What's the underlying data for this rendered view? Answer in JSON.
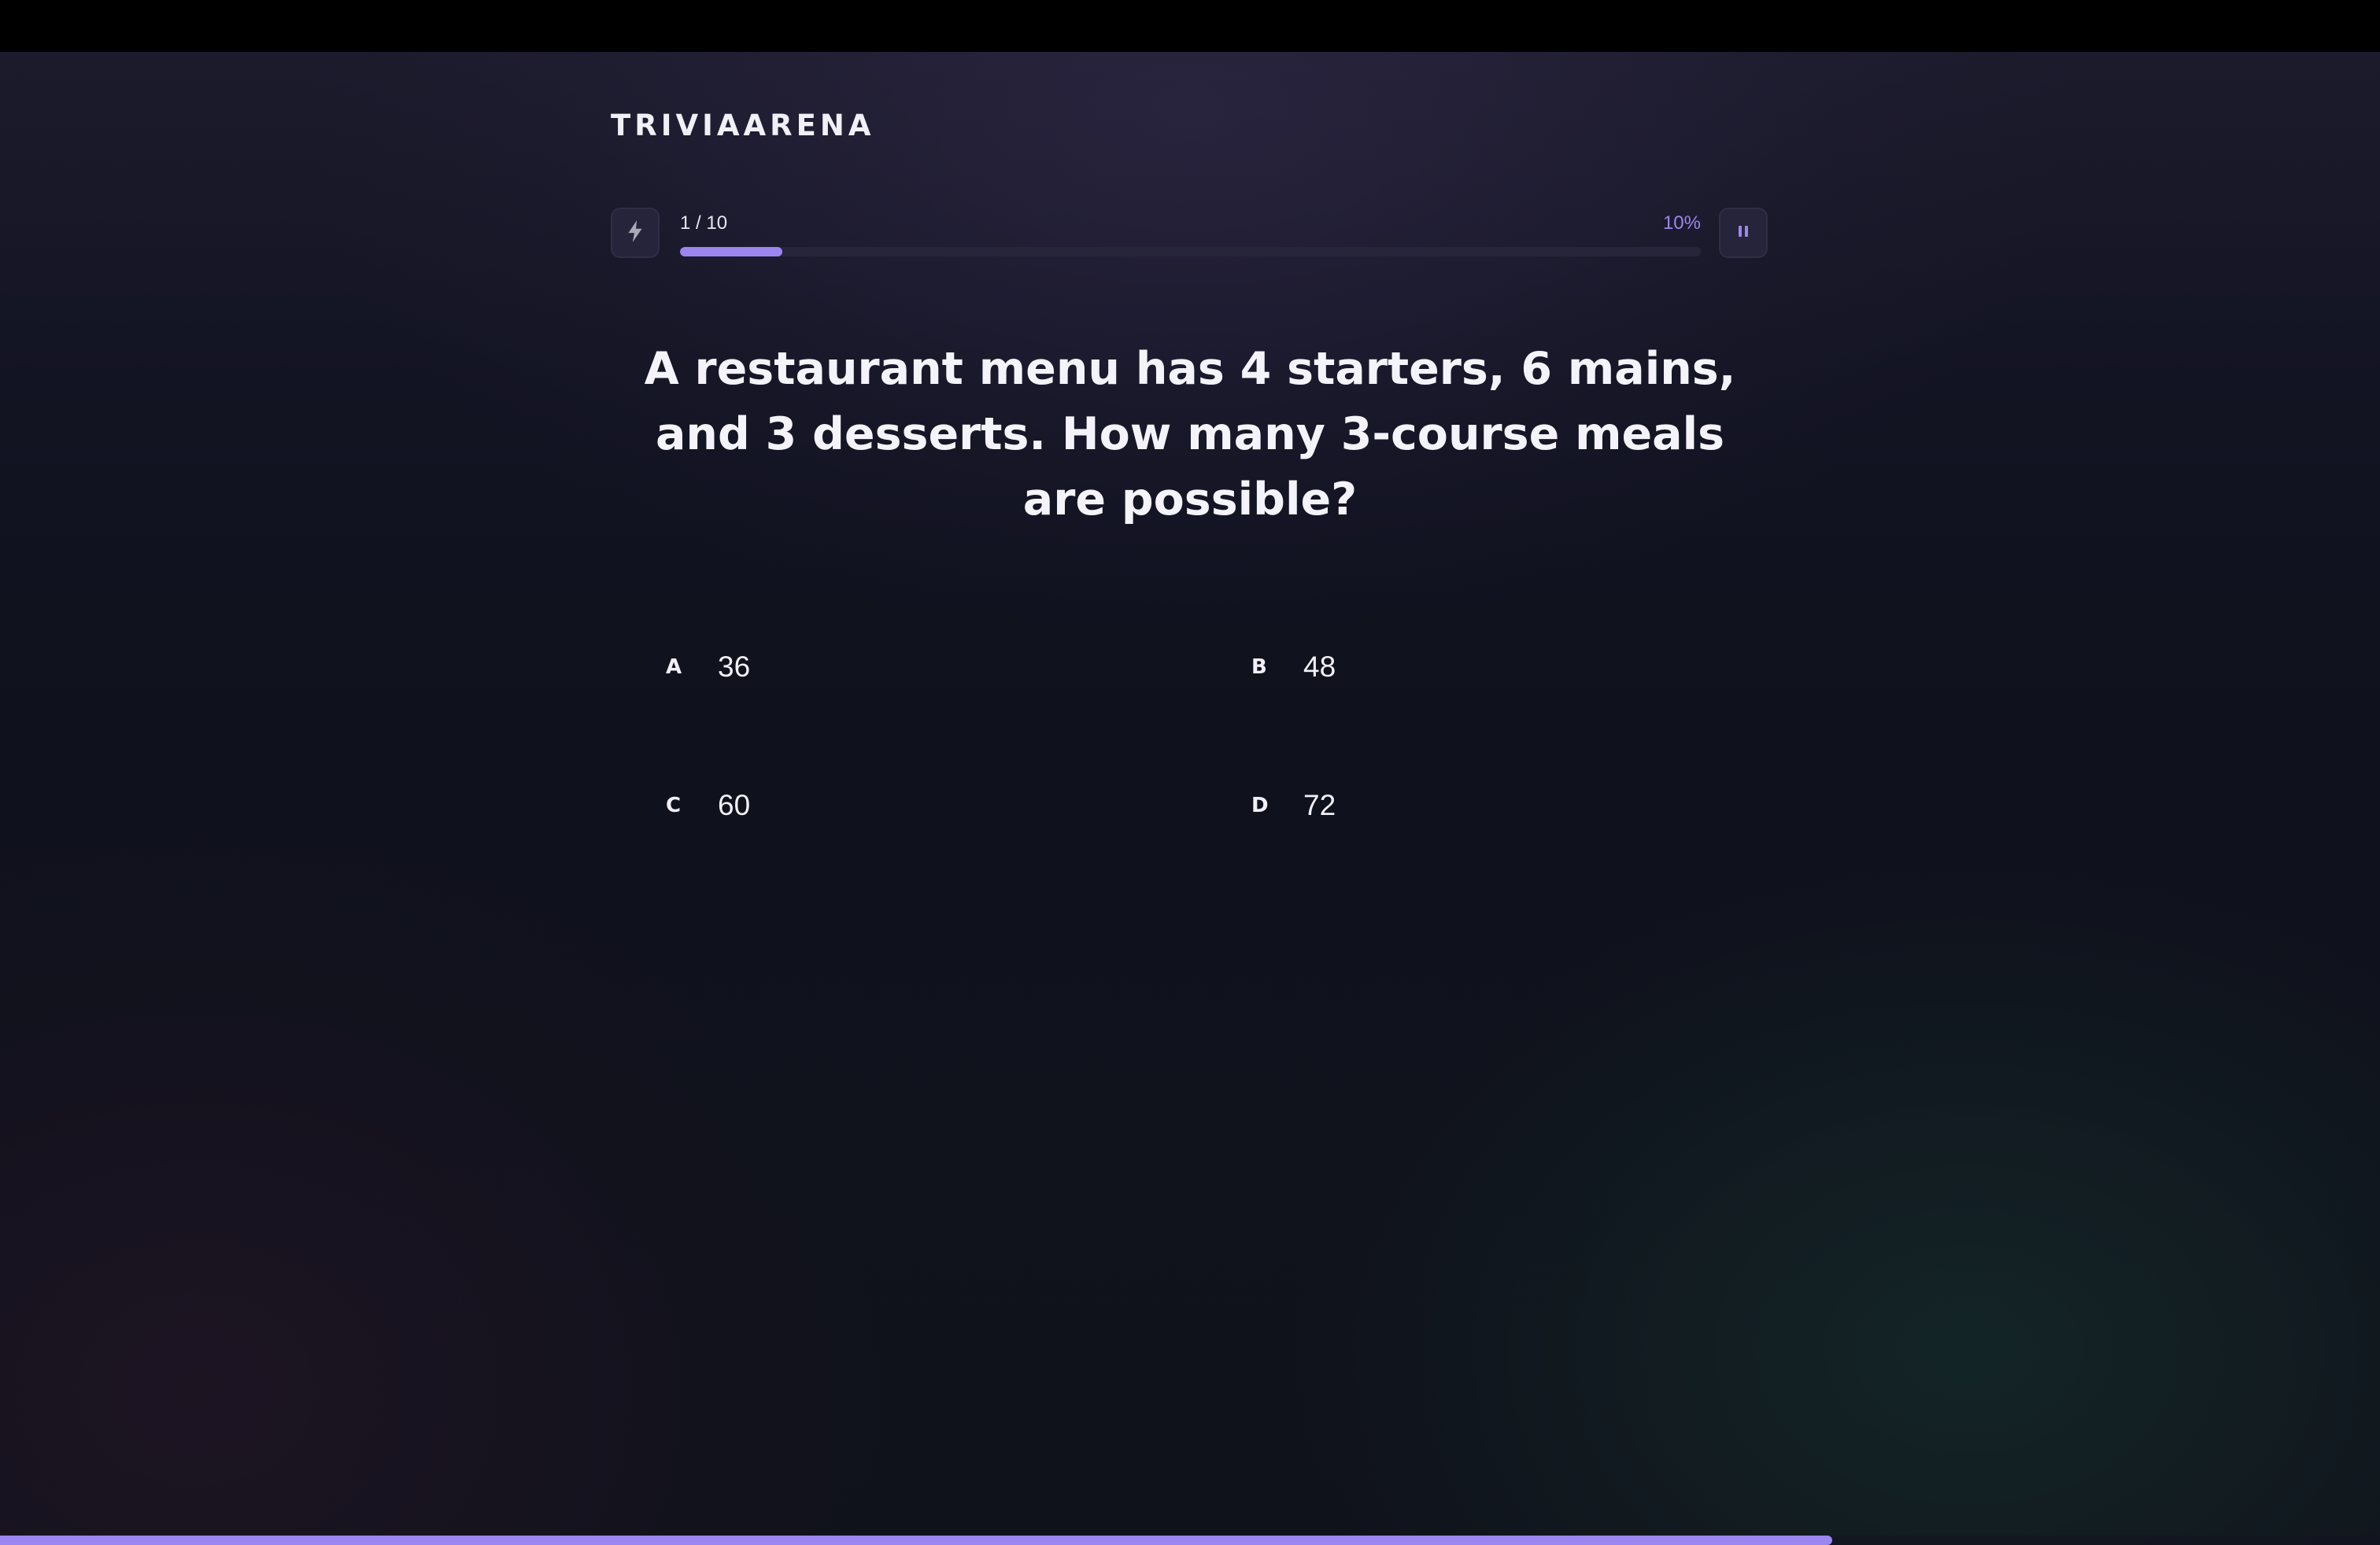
{
  "app": {
    "logo": "TRIVIAARENA"
  },
  "progress": {
    "count_label": "1 / 10",
    "percent_label": "10%",
    "fraction": 0.1
  },
  "controls": {
    "boost_icon": "lightning-bolt-icon",
    "pause_icon": "pause-icon"
  },
  "question": {
    "text": "A restaurant menu has 4 starters, 6 mains, and 3 desserts. How many 3-course meals are possible?"
  },
  "options": [
    {
      "letter": "A",
      "text": "36"
    },
    {
      "letter": "B",
      "text": "48"
    },
    {
      "letter": "C",
      "text": "60"
    },
    {
      "letter": "D",
      "text": "72"
    }
  ],
  "timer": {
    "fraction_remaining": 0.77
  },
  "colors": {
    "accent": "#9b86f0",
    "background": "#10121b",
    "text": "#f1f0f7"
  }
}
